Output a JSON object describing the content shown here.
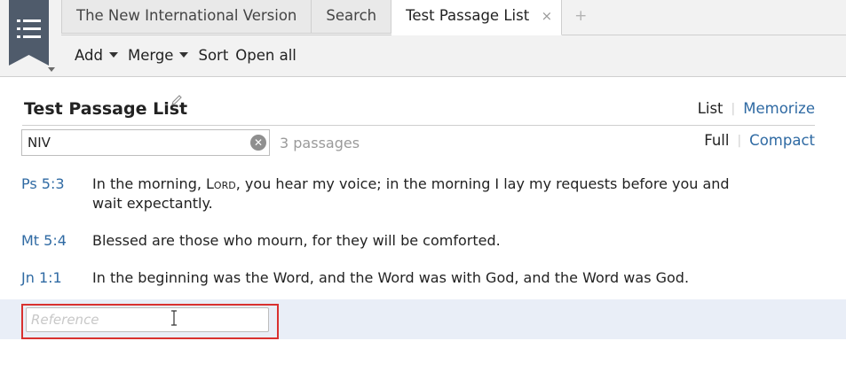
{
  "tabs": [
    {
      "label": "The New International Version"
    },
    {
      "label": "Search"
    },
    {
      "label": "Test Passage List",
      "close": "×"
    }
  ],
  "tab_add": "+",
  "toolbar": {
    "add": "Add",
    "merge": "Merge",
    "sort": "Sort",
    "open_all": "Open all"
  },
  "list": {
    "title": "Test Passage List",
    "view_modes": [
      "List",
      "Memorize"
    ],
    "density_modes": [
      "Full",
      "Compact"
    ],
    "filter_value": "NIV",
    "passage_count": "3 passages"
  },
  "passages": [
    {
      "ref": "Ps 5:3",
      "text_before": "In the morning, ",
      "lord": "Lord",
      "text_after": ", you hear my voice; in the morning I lay my requests before you and wait expectantly."
    },
    {
      "ref": "Mt 5:4",
      "text": "Blessed are those who mourn, for they will be comforted."
    },
    {
      "ref": "Jn 1:1",
      "text": "In the beginning was the Word, and the Word was with God, and the Word was God."
    }
  ],
  "reference_input": {
    "placeholder": "Reference",
    "value": ""
  },
  "colors": {
    "link": "#2f6aa3",
    "highlight_frame": "#d9312f",
    "add_row_bg": "#e9eef7",
    "panel_menu": "#4f5b6b"
  },
  "icons": {
    "panel_menu": "list-bookmark-icon",
    "edit_title": "pencil-icon",
    "clear_filter": "clear-circle-icon",
    "tab_close": "close-icon"
  }
}
